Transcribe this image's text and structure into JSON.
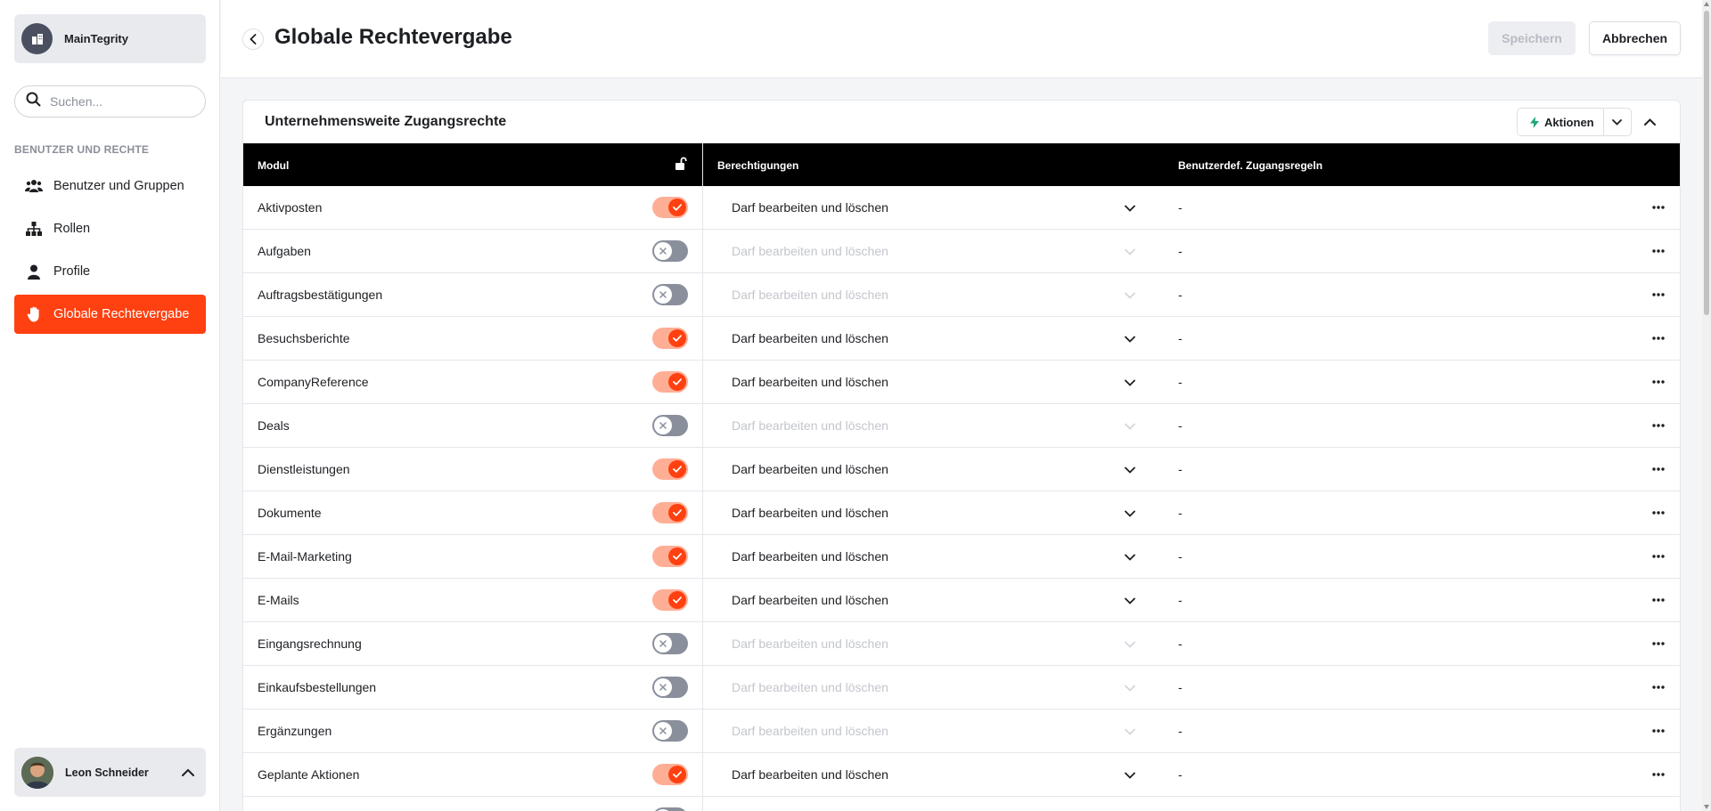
{
  "colors": {
    "accent": "#ff4010",
    "toggle_on_track": "#ffae96",
    "toggle_off_track": "#8a8f9c",
    "table_header": "#000000"
  },
  "sidebar": {
    "org_name": "MainTegrity",
    "search_placeholder": "Suchen...",
    "section_label": "BENUTZER UND RECHTE",
    "items": [
      {
        "label": "Benutzer und Gruppen",
        "icon": "users-icon",
        "active": false
      },
      {
        "label": "Rollen",
        "icon": "hierarchy-icon",
        "active": false
      },
      {
        "label": "Profile",
        "icon": "person-icon",
        "active": false
      },
      {
        "label": "Globale Rechtevergabe",
        "icon": "hand-icon",
        "active": true
      }
    ],
    "user_name": "Leon Schneider"
  },
  "header": {
    "title": "Globale Rechtevergabe",
    "save_label": "Speichern",
    "cancel_label": "Abbrechen"
  },
  "card": {
    "title": "Unternehmensweite Zugangsrechte",
    "actions_label": "Aktionen",
    "columns": {
      "modul": "Modul",
      "permissions": "Berechtigungen",
      "rules": "Benutzerdef. Zugangsregeln"
    },
    "rows": [
      {
        "modul": "Aktivposten",
        "enabled": true,
        "permission": "Darf bearbeiten und löschen",
        "rule": "-"
      },
      {
        "modul": "Aufgaben",
        "enabled": false,
        "permission": "Darf bearbeiten und löschen",
        "rule": "-"
      },
      {
        "modul": "Auftragsbestätigungen",
        "enabled": false,
        "permission": "Darf bearbeiten und löschen",
        "rule": "-"
      },
      {
        "modul": "Besuchsberichte",
        "enabled": true,
        "permission": "Darf bearbeiten und löschen",
        "rule": "-"
      },
      {
        "modul": "CompanyReference",
        "enabled": true,
        "permission": "Darf bearbeiten und löschen",
        "rule": "-"
      },
      {
        "modul": "Deals",
        "enabled": false,
        "permission": "Darf bearbeiten und löschen",
        "rule": "-"
      },
      {
        "modul": "Dienstleistungen",
        "enabled": true,
        "permission": "Darf bearbeiten und löschen",
        "rule": "-"
      },
      {
        "modul": "Dokumente",
        "enabled": true,
        "permission": "Darf bearbeiten und löschen",
        "rule": "-"
      },
      {
        "modul": "E-Mail-Marketing",
        "enabled": true,
        "permission": "Darf bearbeiten und löschen",
        "rule": "-"
      },
      {
        "modul": "E-Mails",
        "enabled": true,
        "permission": "Darf bearbeiten und löschen",
        "rule": "-"
      },
      {
        "modul": "Eingangsrechnung",
        "enabled": false,
        "permission": "Darf bearbeiten und löschen",
        "rule": "-"
      },
      {
        "modul": "Einkaufsbestellungen",
        "enabled": false,
        "permission": "Darf bearbeiten und löschen",
        "rule": "-"
      },
      {
        "modul": "Ergänzungen",
        "enabled": false,
        "permission": "Darf bearbeiten und löschen",
        "rule": "-"
      },
      {
        "modul": "Geplante Aktionen",
        "enabled": true,
        "permission": "Darf bearbeiten und löschen",
        "rule": "-"
      },
      {
        "modul": "",
        "enabled": false,
        "permission": "",
        "rule": ""
      }
    ]
  }
}
